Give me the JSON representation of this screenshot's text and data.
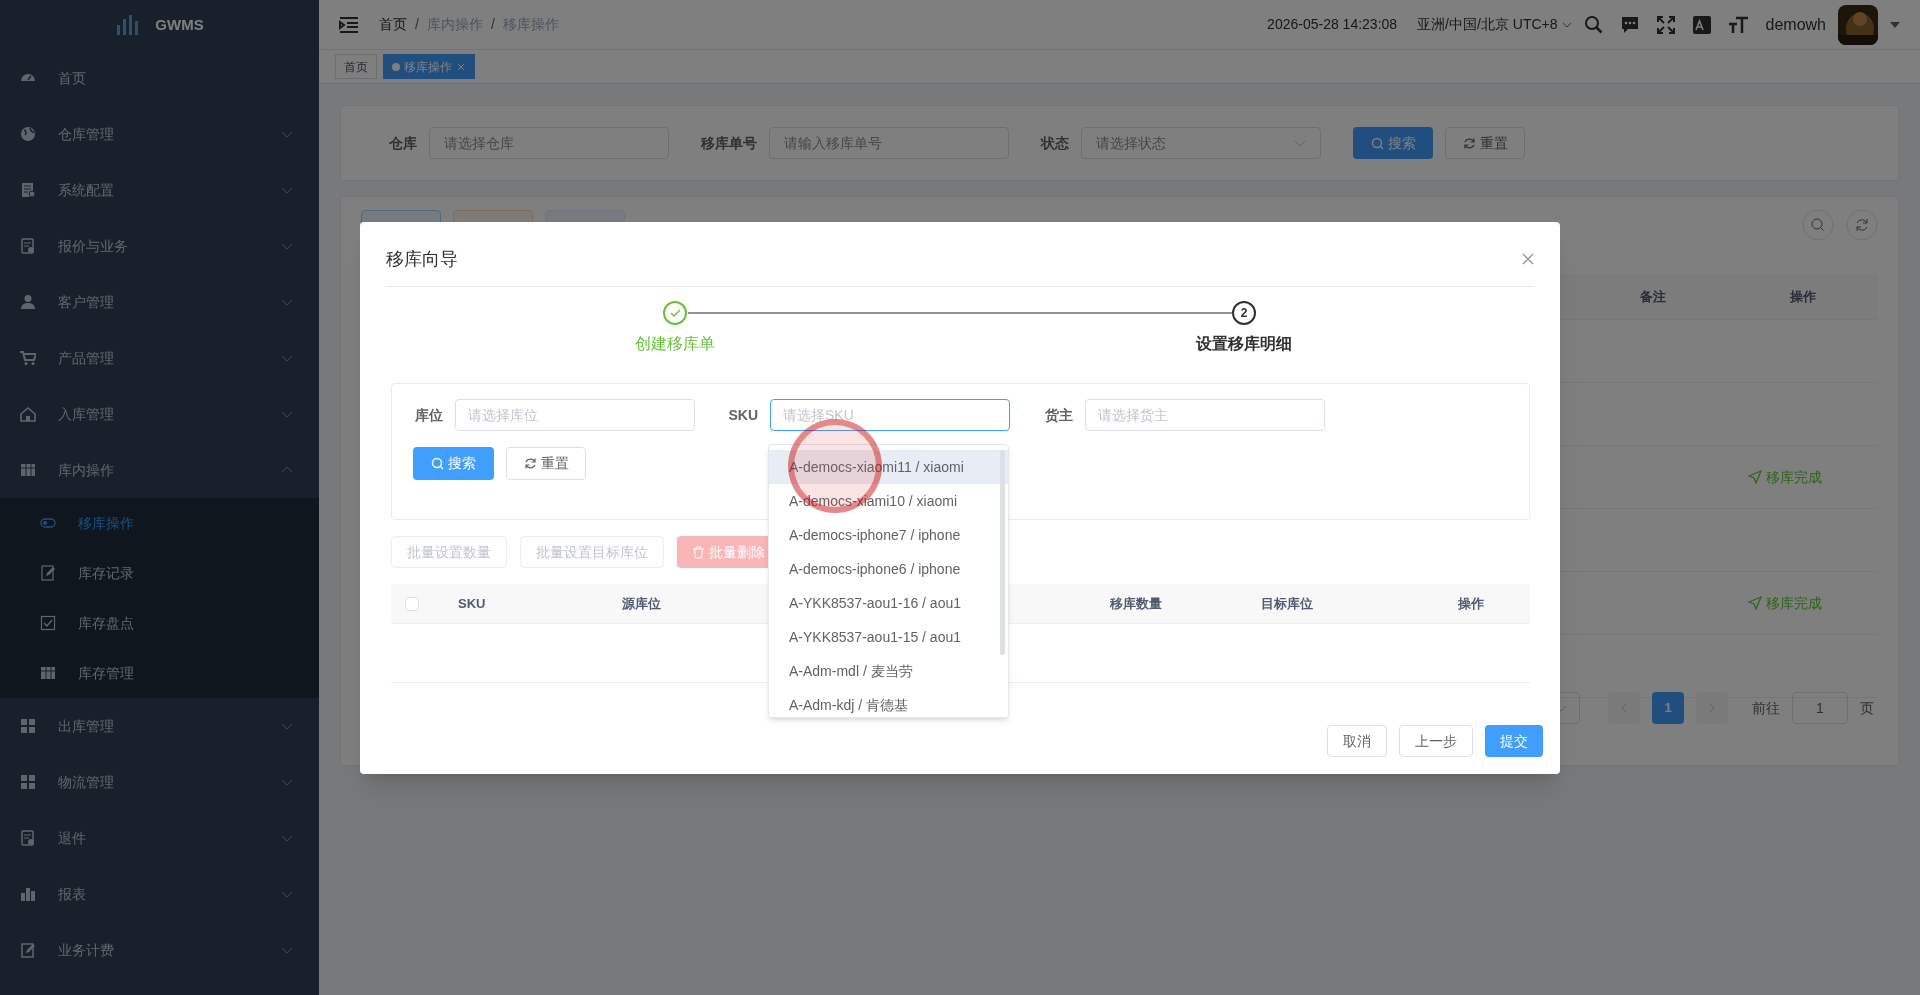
{
  "app": {
    "name": "GWMS"
  },
  "sidebar": {
    "items": [
      {
        "label": "首页",
        "kind": "link",
        "selected": false
      },
      {
        "label": "仓库管理",
        "kind": "group",
        "expanded": false
      },
      {
        "label": "系统配置",
        "kind": "group",
        "expanded": false
      },
      {
        "label": "报价与业务",
        "kind": "group",
        "expanded": false
      },
      {
        "label": "客户管理",
        "kind": "group",
        "expanded": false
      },
      {
        "label": "产品管理",
        "kind": "group",
        "expanded": false
      },
      {
        "label": "入库管理",
        "kind": "group",
        "expanded": false
      },
      {
        "label": "库内操作",
        "kind": "group",
        "expanded": true,
        "children": [
          {
            "label": "移库操作",
            "selected": true
          },
          {
            "label": "库存记录",
            "selected": false
          },
          {
            "label": "库存盘点",
            "selected": false
          },
          {
            "label": "库存管理",
            "selected": false
          }
        ]
      },
      {
        "label": "出库管理",
        "kind": "group",
        "expanded": false
      },
      {
        "label": "物流管理",
        "kind": "group",
        "expanded": false
      },
      {
        "label": "退件",
        "kind": "group",
        "expanded": false
      },
      {
        "label": "报表",
        "kind": "group",
        "expanded": false
      },
      {
        "label": "业务计费",
        "kind": "group",
        "expanded": false
      }
    ]
  },
  "header": {
    "breadcrumb": [
      "首页",
      "库内操作",
      "移库操作"
    ],
    "breadcrumb_separator": "/",
    "datetime": "2026-05-28 14:23:08",
    "timezone": "亚洲/中国/北京 UTC+8",
    "user": "demowh"
  },
  "tags": [
    {
      "label": "首页",
      "selected": false,
      "closable": false
    },
    {
      "label": "移库操作",
      "selected": true,
      "closable": true
    }
  ],
  "filter": {
    "fields": [
      {
        "label": "仓库",
        "placeholder": "请选择仓库",
        "kind": "input"
      },
      {
        "label": "移库单号",
        "placeholder": "请输入移库单号",
        "kind": "input"
      },
      {
        "label": "状态",
        "placeholder": "请选择状态",
        "kind": "select"
      }
    ],
    "search": "搜索",
    "reset": "重置"
  },
  "table": {
    "columns": [
      "备注",
      "操作"
    ],
    "rows": [
      {
        "action": "移库完成"
      },
      {
        "action": "移库完成"
      }
    ]
  },
  "pagination": {
    "page": "1",
    "goto": "前往",
    "goto_value": "1",
    "page_unit": "页"
  },
  "dialog": {
    "title": "移库向导",
    "steps": [
      {
        "label": "创建移库单",
        "completed": true
      },
      {
        "label": "设置移库明细",
        "completed": false,
        "number": "2"
      }
    ],
    "select_all_checked": false,
    "fields": [
      {
        "label": "库位",
        "placeholder": "请选择库位",
        "focused": false
      },
      {
        "label": "SKU",
        "placeholder": "请选择SKU",
        "focused": true
      },
      {
        "label": "货主",
        "placeholder": "请选择货主",
        "focused": false
      }
    ],
    "search": "搜索",
    "reset": "重置",
    "batch_buttons": [
      {
        "label": "批量设置数量",
        "kind": "plain"
      },
      {
        "label": "批量设置目标库位",
        "kind": "plain"
      },
      {
        "label": "批量删除",
        "kind": "danger"
      }
    ],
    "columns": [
      {
        "label": "SKU"
      },
      {
        "label": "源库位"
      },
      {
        "label": "移库数量"
      },
      {
        "label": "目标库位"
      },
      {
        "label": "操作"
      }
    ],
    "sku_options": [
      {
        "label": "A-democs-xiaomi11 / xiaomi",
        "hovered": true
      },
      {
        "label": "A-democs-xiami10 / xiaomi",
        "hovered": false
      },
      {
        "label": "A-democs-iphone7 / iphone",
        "hovered": false
      },
      {
        "label": "A-democs-iphone6 / iphone",
        "hovered": false
      },
      {
        "label": "A-YKK8537-aou1-16 / aou1",
        "hovered": false
      },
      {
        "label": "A-YKK8537-aou1-15 / aou1",
        "hovered": false
      },
      {
        "label": "A-Adm-mdl / 麦当劳",
        "hovered": false
      },
      {
        "label": "A-Adm-kdj / 肯德基",
        "hovered": false
      }
    ],
    "footer": [
      {
        "label": "取消",
        "kind": "plain"
      },
      {
        "label": "上一步",
        "kind": "plain"
      },
      {
        "label": "提交",
        "kind": "primary"
      }
    ]
  }
}
